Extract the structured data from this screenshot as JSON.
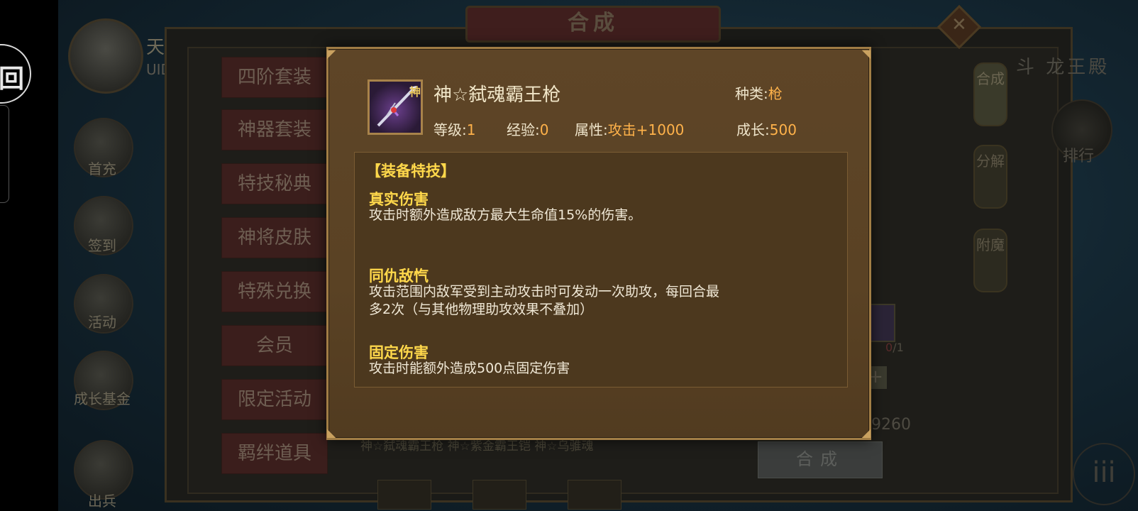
{
  "side_overlay": {
    "icon_glyph": "回"
  },
  "scene": {
    "player_name": "天魔",
    "player_uid": "UID",
    "top_title": "合成",
    "close_glyph": "✕",
    "right_title": "斗 龙王殿",
    "left_icons": [
      "首充",
      "签到",
      "活动",
      "成长基金",
      "出兵"
    ],
    "menu": [
      "四阶套装",
      "神器套装",
      "特技秘典",
      "神将皮肤",
      "特殊兑换",
      "会员",
      "限定活动",
      "羁绊道具"
    ],
    "right_tabs": [
      "合成",
      "分解",
      "附魔"
    ],
    "far_right_label": "排行",
    "slot_count_have": "0",
    "slot_count_need": "/1",
    "plus_glyph": "+",
    "gold": "9260",
    "craft_button": "合成",
    "bottom_items": "神☆弑魂霸王枪  神☆紫金霸王铠  神☆乌骓魂",
    "bottom_right_glyph": "iii"
  },
  "popup": {
    "item": {
      "badge": "神",
      "name": "神☆弑魂霸王枪",
      "type_label": "种类:",
      "type_value": "枪",
      "level_label": "等级:",
      "level_value": "1",
      "exp_label": "经验:",
      "exp_value": "0",
      "attr_label": "属性:",
      "attr_value": "攻击+1000",
      "growth_label": "成长:",
      "growth_value": "500"
    },
    "section_header": "【装备特技】",
    "skills": [
      {
        "title": "真实伤害",
        "text": "攻击时额外造成敌方最大生命值15%的伤害。"
      },
      {
        "title": "同仇敌忾",
        "text": "攻击范围内敌军受到主动攻击时可发动一次助攻，每回合最多2次（与其他物理助攻效果不叠加）"
      },
      {
        "title": "固定伤害",
        "text": "攻击时能额外造成500点固定伤害"
      }
    ],
    "colors": {
      "gold_title": "#ffd84b",
      "value_orange": "#ffb24a",
      "frame": "#a17d45"
    }
  }
}
